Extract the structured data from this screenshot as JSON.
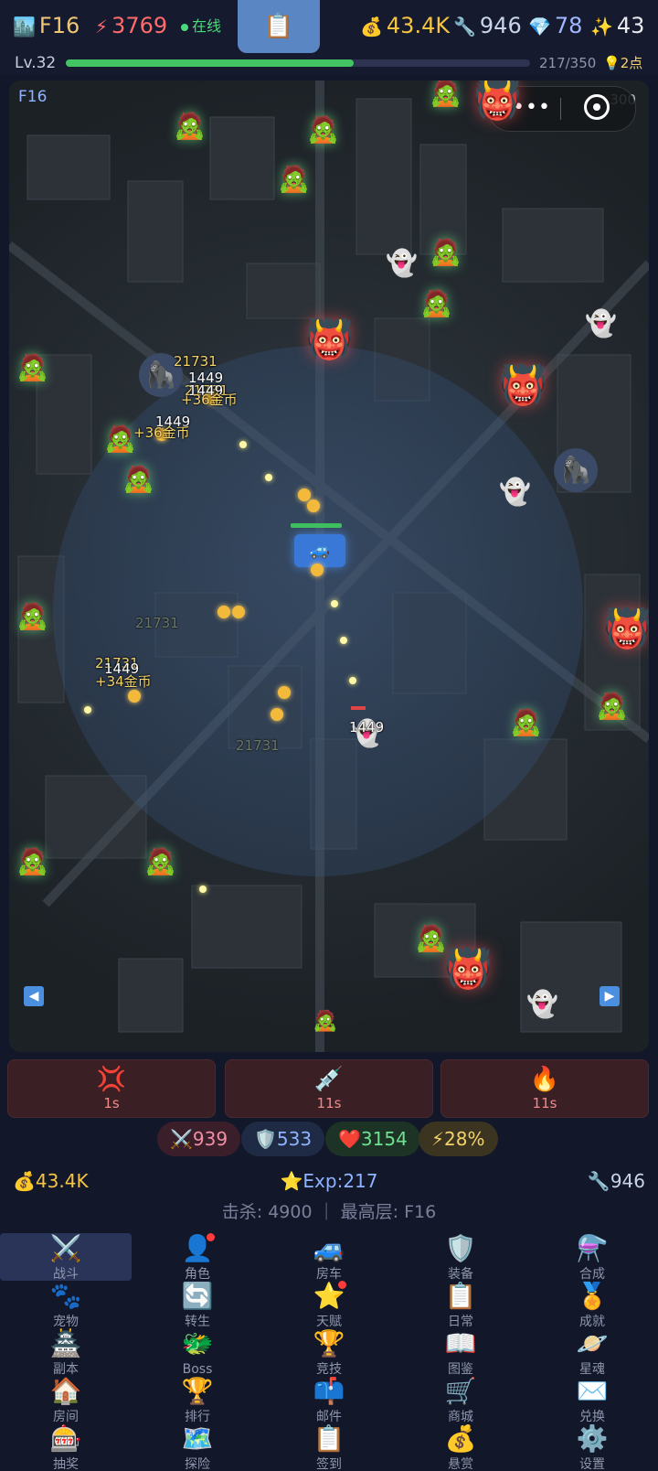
{
  "topbar": {
    "floor": "F16",
    "power": "3769",
    "online_status": "在线",
    "gold": "43.4K",
    "tools": "946",
    "gems": "78",
    "sparks": "43"
  },
  "level": {
    "label": "Lv.32",
    "exp_text": "217/350",
    "exp_progress": 0.62,
    "points": "2点"
  },
  "map": {
    "floor_label": "F16",
    "counter": "300",
    "damage_texts": [
      "21731",
      "1449",
      "21731",
      "1449",
      "+36金币",
      "1449",
      "+36金币",
      "21731",
      "21731",
      "1449",
      "+34金币",
      "21731",
      "1449"
    ]
  },
  "skills": [
    {
      "icon": "💢",
      "cooldown": "1s"
    },
    {
      "icon": "💉",
      "cooldown": "11s"
    },
    {
      "icon": "🔥",
      "cooldown": "11s"
    }
  ],
  "stats": {
    "attack": "939",
    "defense": "533",
    "hp": "3154",
    "crit": "28%"
  },
  "resources": {
    "gold": "43.4K",
    "exp": "Exp:217",
    "tools": "946"
  },
  "summary": "击杀: 4900 ｜ 最高层: F16",
  "menu": [
    {
      "icon": "⚔️",
      "label": "战斗"
    },
    {
      "icon": "👤",
      "label": "角色"
    },
    {
      "icon": "🚙",
      "label": "房车"
    },
    {
      "icon": "🛡️",
      "label": "装备"
    },
    {
      "icon": "⚗️",
      "label": "合成"
    },
    {
      "icon": "🐾",
      "label": "宠物"
    },
    {
      "icon": "🔄",
      "label": "转生"
    },
    {
      "icon": "⭐",
      "label": "天赋"
    },
    {
      "icon": "📋",
      "label": "日常"
    },
    {
      "icon": "🏅",
      "label": "成就"
    },
    {
      "icon": "🏯",
      "label": "副本"
    },
    {
      "icon": "🐲",
      "label": "Boss"
    },
    {
      "icon": "🏆",
      "label": "竞技"
    },
    {
      "icon": "📖",
      "label": "图鉴"
    },
    {
      "icon": "🪐",
      "label": "星魂"
    },
    {
      "icon": "🏠",
      "label": "房间"
    },
    {
      "icon": "🏆",
      "label": "排行"
    },
    {
      "icon": "📫",
      "label": "邮件"
    },
    {
      "icon": "🛒",
      "label": "商城"
    },
    {
      "icon": "✉️",
      "label": "兑换"
    },
    {
      "icon": "🎰",
      "label": "抽奖"
    },
    {
      "icon": "🗺️",
      "label": "探险"
    },
    {
      "icon": "📋",
      "label": "签到"
    },
    {
      "icon": "💰",
      "label": "悬赏"
    },
    {
      "icon": "⚙️",
      "label": "设置"
    }
  ]
}
